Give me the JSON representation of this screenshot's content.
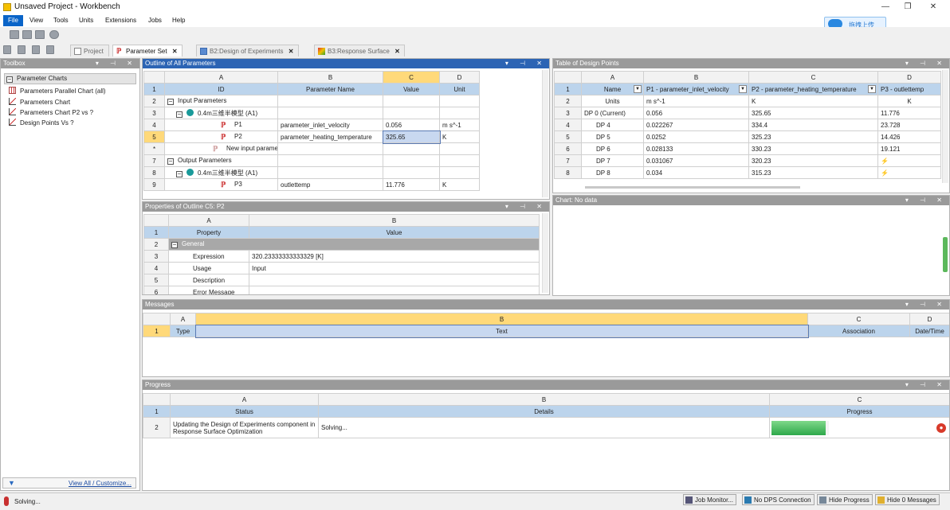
{
  "window": {
    "title": "Unsaved Project - Workbench",
    "min": "—",
    "max": "❐",
    "close": "✕"
  },
  "menu": [
    "File",
    "View",
    "Tools",
    "Units",
    "Extensions",
    "Jobs",
    "Help"
  ],
  "upload_label": "拖拽上传",
  "tabs": [
    {
      "label": "Project"
    },
    {
      "label": "Parameter Set"
    },
    {
      "label": "B2:Design of Experiments"
    },
    {
      "label": "B3:Response Surface"
    }
  ],
  "toolbox": {
    "title": "Toolbox",
    "section": "Parameter Charts",
    "items": [
      "Parameters Parallel Chart (all)",
      "Parameters Chart",
      "Parameters Chart P2 vs ?",
      "Design Points Vs ?"
    ],
    "footer": "View All / Customize..."
  },
  "outline": {
    "title": "Outline of All Parameters",
    "cols": [
      "A",
      "B",
      "C",
      "D"
    ],
    "headers": [
      "ID",
      "Parameter Name",
      "Value",
      "Unit"
    ],
    "rows": [
      {
        "n": "1",
        "id": "ID"
      },
      {
        "n": "2",
        "id": "Input Parameters",
        "type": "section"
      },
      {
        "n": "3",
        "id": "0.4m三维半模型 (A1)",
        "type": "group"
      },
      {
        "n": "4",
        "id": "P1",
        "name": "parameter_inlet_velocity",
        "value": "0.056",
        "unit": "m s^-1"
      },
      {
        "n": "5",
        "id": "P2",
        "name": "parameter_heating_temperature",
        "value": "325.65",
        "unit": "K"
      },
      {
        "n": "*",
        "id": "New input parameter",
        "type": "new"
      },
      {
        "n": "7",
        "id": "Output Parameters",
        "type": "section"
      },
      {
        "n": "8",
        "id": "0.4m三维半模型 (A1)",
        "type": "group"
      },
      {
        "n": "9",
        "id": "P3",
        "name": "outlettemp",
        "value": "11.776",
        "unit": "K"
      }
    ]
  },
  "properties": {
    "title": "Properties of Outline C5: P2",
    "cols": [
      "A",
      "B"
    ],
    "headers": [
      "Property",
      "Value"
    ],
    "rows": [
      {
        "n": "2",
        "prop": "General",
        "type": "section"
      },
      {
        "n": "3",
        "prop": "Expression",
        "value": "320.23333333333329 [K]"
      },
      {
        "n": "4",
        "prop": "Usage",
        "value": "Input"
      },
      {
        "n": "5",
        "prop": "Description",
        "value": ""
      },
      {
        "n": "6",
        "prop": "Error Message",
        "value": ""
      }
    ]
  },
  "design_points": {
    "title": "Table of Design Points",
    "cols": [
      "A",
      "B",
      "C",
      "D"
    ],
    "headers": [
      "Name",
      "P1 - parameter_inlet_velocity",
      "P2 - parameter_heating_temperature",
      "P3 - outlettemp"
    ],
    "units": {
      "name": "Units",
      "p1": "m s^-1",
      "p2": "K",
      "p3": "K"
    },
    "rows": [
      {
        "n": "3",
        "name": "DP 0 (Current)",
        "p1": "0.056",
        "p2": "325.65",
        "p3": "11.776"
      },
      {
        "n": "4",
        "name": "DP 4",
        "p1": "0.022267",
        "p2": "334.4",
        "p3": "23.728"
      },
      {
        "n": "5",
        "name": "DP 5",
        "p1": "0.0252",
        "p2": "325.23",
        "p3": "14.426"
      },
      {
        "n": "6",
        "name": "DP 6",
        "p1": "0.028133",
        "p2": "330.23",
        "p3": "19.121"
      },
      {
        "n": "7",
        "name": "DP 7",
        "p1": "0.031067",
        "p2": "320.23",
        "p3": "⚡"
      },
      {
        "n": "8",
        "name": "DP 8",
        "p1": "0.034",
        "p2": "315.23",
        "p3": "⚡"
      }
    ]
  },
  "chart": {
    "title": "Chart: No data"
  },
  "messages": {
    "title": "Messages",
    "cols": [
      "A",
      "B",
      "C",
      "D"
    ],
    "headers": [
      "Type",
      "Text",
      "Association",
      "Date/Time"
    ]
  },
  "progress": {
    "title": "Progress",
    "cols": [
      "A",
      "B",
      "C"
    ],
    "headers": [
      "Status",
      "Details",
      "Progress"
    ],
    "row": {
      "n": "2",
      "status": "Updating the Design of Experiments component in Response Surface Optimization",
      "details": "Solving...",
      "fraction": 0.95
    }
  },
  "status": {
    "text": "Solving...",
    "buttons": [
      "Job Monitor...",
      "No DPS Connection",
      "Hide Progress",
      "Hide 0 Messages"
    ]
  }
}
